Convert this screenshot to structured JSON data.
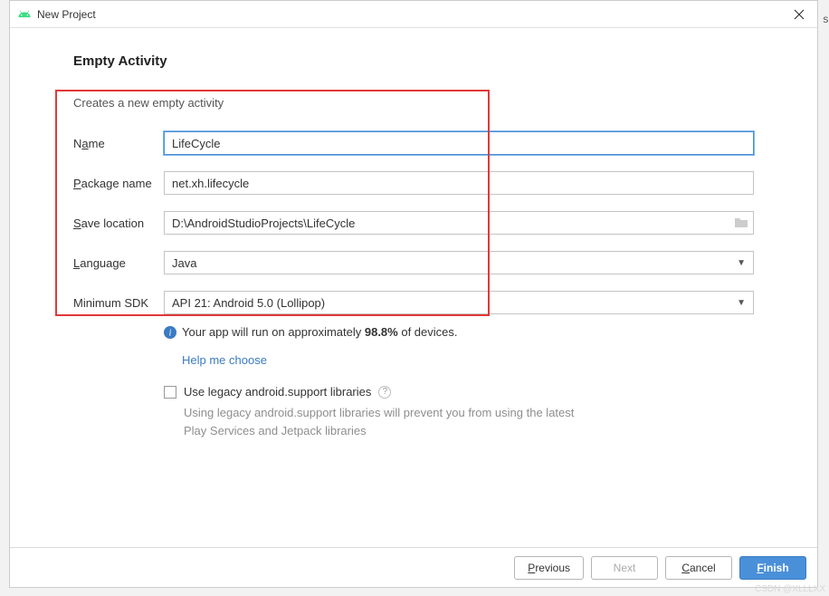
{
  "window": {
    "title": "New Project"
  },
  "page": {
    "title": "Empty Activity",
    "subtitle": "Creates a new empty activity"
  },
  "form": {
    "name": {
      "label_pre": "N",
      "label_u": "a",
      "label_post": "me",
      "value": "LifeCycle"
    },
    "package": {
      "label_u": "P",
      "label_post": "ackage name",
      "value": "net.xh.lifecycle"
    },
    "save": {
      "label_u": "S",
      "label_post": "ave location",
      "value": "D:\\AndroidStudioProjects\\LifeCycle"
    },
    "language": {
      "label_u": "L",
      "label_post": "anguage",
      "value": "Java"
    },
    "minsdk": {
      "label": "Minimum SDK",
      "value": "API 21: Android 5.0 (Lollipop)"
    }
  },
  "info": {
    "text_pre": "Your app will run on approximately ",
    "percent": "98.8%",
    "text_post": " of devices.",
    "help": "Help me choose"
  },
  "legacy": {
    "label": "Use legacy android.support libraries",
    "hint": "Using legacy android.support libraries will prevent you from using the latest Play Services and Jetpack libraries"
  },
  "buttons": {
    "previous_u": "P",
    "previous_post": "revious",
    "next": "Next",
    "cancel_u": "C",
    "cancel_post": "ancel",
    "finish_u": "F",
    "finish_post": "inish"
  },
  "watermark": "CSDN @XLLLXX",
  "side": "si"
}
